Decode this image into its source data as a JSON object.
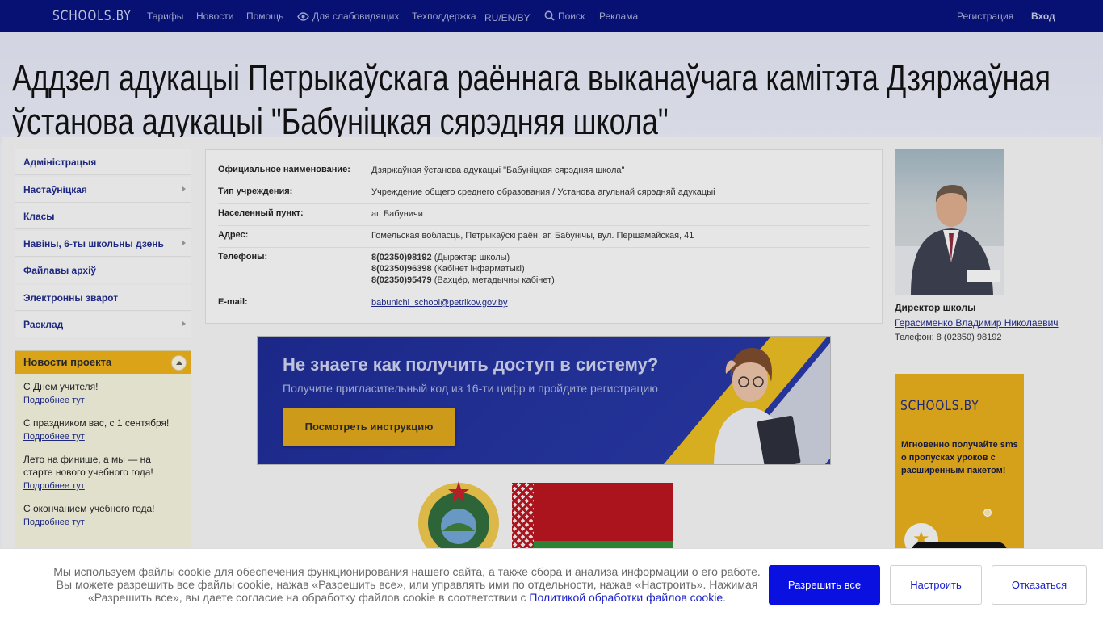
{
  "topbar": {
    "logo": "SCHOOLS.BY",
    "nav": [
      "Тарифы",
      "Новости",
      "Помощь",
      "Для слабовидящих",
      "Техподдержка",
      "RU/EN/BY",
      "Поиск",
      "Реклама"
    ],
    "register": "Регистрация",
    "login": "Вход"
  },
  "hero": {
    "title": "Аддзел адукацыі Петрыкаўскага раённага выканаўчага камітэта Дзяржаўная ўстанова адукацыі \"Бабуніцкая сярэдняя школа\""
  },
  "sidebar": {
    "items": [
      {
        "label": "Адміністрацыя",
        "has_arrow": false
      },
      {
        "label": "Настаўніцкая",
        "has_arrow": true
      },
      {
        "label": "Класы",
        "has_arrow": false
      },
      {
        "label": "Навіны, 6-ты школьны дзень",
        "has_arrow": true
      },
      {
        "label": "Файлавы архіў",
        "has_arrow": false
      },
      {
        "label": "Электронны зварот",
        "has_arrow": false
      },
      {
        "label": "Расклад",
        "has_arrow": true
      }
    ]
  },
  "news": {
    "title": "Новости проекта",
    "more": "Подробнее тут",
    "items": [
      "С Днем учителя!",
      "С праздником вас, с 1 сентября!",
      "Лето на финише, а мы — на старте нового учебного года!",
      "С окончанием учебного года!"
    ]
  },
  "info": {
    "rows": [
      {
        "label": "Официальное наименование:",
        "value": "Дзяржаўная ўстанова адукацыі \"Бабуніцкая сярэдняя школа\""
      },
      {
        "label": "Тип учреждения:",
        "value": "Учреждение общего среднего образования / Установа агульнай сярэдняй адукацыі"
      },
      {
        "label": "Населенный пункт:",
        "value": "аг. Бабуничи"
      },
      {
        "label": "Адрес:",
        "value": "Гомельская вобласць, Петрыкаўскі раён, аг. Бабунічы, вул. Першамайская, 41"
      },
      {
        "label": "Телефоны:",
        "value": ""
      },
      {
        "label": "E-mail:",
        "value": "babunichi_school@petrikov.gov.by"
      }
    ],
    "phones": [
      {
        "number": "8(02350)98192",
        "note": "(Дырэктар школы)"
      },
      {
        "number": "8(02350)96398",
        "note": "(Кабінет інфарматыкі)"
      },
      {
        "number": "8(02350)95479",
        "note": "(Вахцёр, метадычны кабінет)"
      }
    ]
  },
  "banner": {
    "title": "Не знаете как получить доступ в систему?",
    "subtitle": "Получите пригласительный код из 16-ти цифр и пройдите регистрацию",
    "button": "Посмотреть инструкцию"
  },
  "director": {
    "role": "Директор школы",
    "name": "Герасименко Владимир Николаевич",
    "phone": "Телефон: 8 (02350) 98192"
  },
  "ad": {
    "logo": "SCHOOLS.BY",
    "text": "Мгновенно получайте sms о пропусках уроков с расширенным пакетом!"
  },
  "cookie": {
    "text": "Мы используем файлы cookie для обеспечения функционирования нашего сайта, а также сбора и анализа информации о его работе. Вы можете разрешить все файлы cookie, нажав «Разрешить все», или управлять ими по отдельности, нажав «Настроить». Нажимая «Разрешить все», вы даете согласие на обработку файлов cookie в соответствии с",
    "link": "Политикой обработки файлов cookie",
    "suffix": ".",
    "allow": "Разрешить все",
    "configure": "Настроить",
    "decline": "Отказаться"
  },
  "colors": {
    "nav_bg": "#07127a",
    "link": "#1f2a86",
    "accent": "#e7ad18",
    "primary_button": "#0a10e0"
  }
}
